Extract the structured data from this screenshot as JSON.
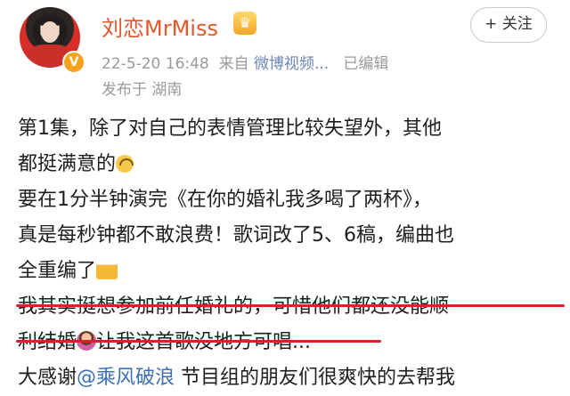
{
  "post": {
    "username": "刘恋MrMiss",
    "crown_icon": "crown-icon",
    "verified_icon": "verified-badge-icon",
    "timestamp": "22-5-20 16:48",
    "source_prefix": "来自",
    "source": "微博视频...",
    "edited": "已编辑",
    "location": "发布于 湖南",
    "follow_label": "+ 关注",
    "text_lines": [
      "第1集，除了对自己的表情管理比较失望外，其他",
      "都挺满意的",
      "要在1分半钟演完《在你的婚礼我多喝了两杯》，",
      "真是每秒钟都不敢浪费！歌词改了5、6稿，编曲也",
      "全重编了",
      "我其实挺想参加前任婚礼的，可惜他们都还没能顺",
      "利结婚",
      "让我这首歌没地方可唱...",
      "大感谢",
      "@乘风破浪",
      " 节目组的朋友们很爽快的去帮我"
    ]
  },
  "colors": {
    "username": "#e5572b",
    "mention": "#3b6fb6",
    "highlight_underline": "#d8222a",
    "meta": "#9a9a9a"
  }
}
